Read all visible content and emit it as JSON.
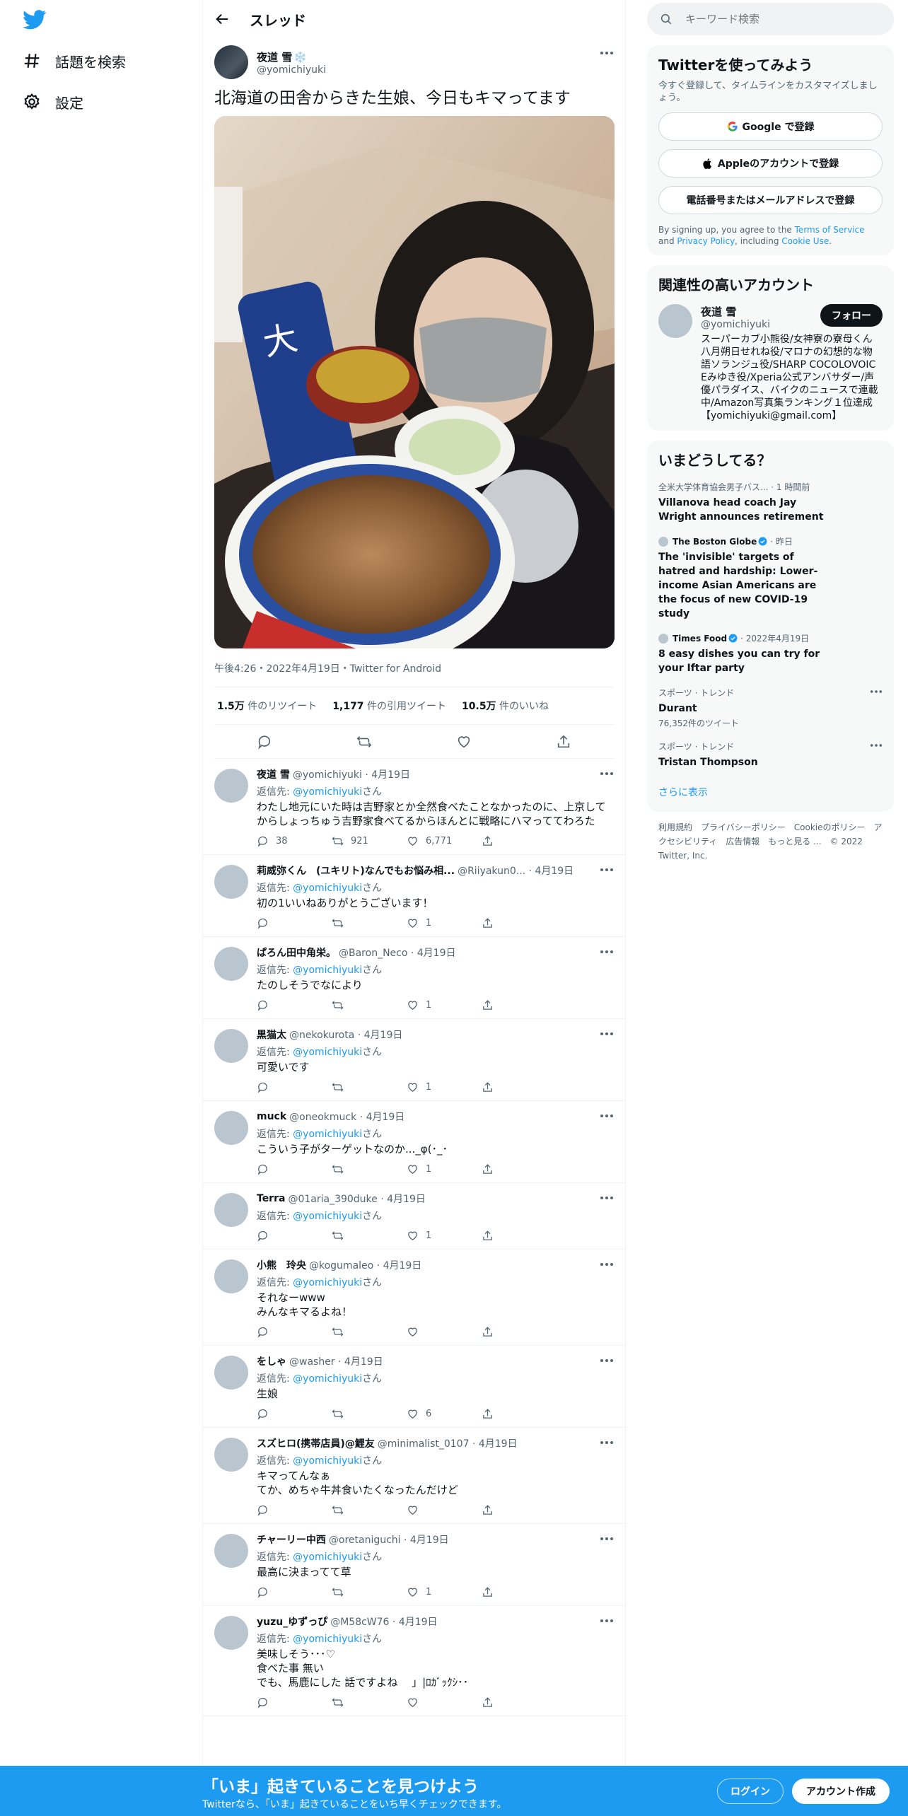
{
  "nav": {
    "explore_label": "話題を検索",
    "settings_label": "設定"
  },
  "header": {
    "title": "スレッド"
  },
  "tweet": {
    "author_name": "夜道 雪",
    "snow_emoji": "❄️",
    "author_handle": "@yomichiyuki",
    "text": "北海道の田舎からきた生娘、今日もキマってます",
    "meta": "午後4:26・2022年4月19日・Twitter for Android",
    "stats": [
      {
        "value": "1.5万",
        "label": "件のリツイート"
      },
      {
        "value": "1,177",
        "label": "件の引用ツイート"
      },
      {
        "value": "10.5万",
        "label": "件のいいね"
      }
    ]
  },
  "reply_to_prefix": "返信先: ",
  "reply_to_mention": "@yomichiyuki",
  "reply_to_suffix": "さん",
  "replies": [
    {
      "name": "夜道 雪",
      "handle": "@yomichiyuki · 4月19日",
      "text": "わたし地元にいた時は吉野家とか全然食べたことなかったのに、上京してからしょっちゅう吉野家食べてるからほんとに戦略にハマっててわろた",
      "reply_count": "38",
      "retweet_count": "921",
      "like_count": "6,771"
    },
    {
      "name": "莉威弥くん　(ユキリト)なんでもお悩み相...",
      "handle": "@Riiyakun0... · 4月19日",
      "text": "初の1いいねありがとうございます！",
      "reply_count": "",
      "retweet_count": "",
      "like_count": "1"
    },
    {
      "name": "ぱろん田中角栄。",
      "handle": "@Baron_Neco · 4月19日",
      "text": "たのしそうでなにより",
      "reply_count": "",
      "retweet_count": "",
      "like_count": "1"
    },
    {
      "name": "黒猫太",
      "handle": "@nekokurota · 4月19日",
      "text": "可愛いです",
      "reply_count": "",
      "retweet_count": "",
      "like_count": "1"
    },
    {
      "name": "muck",
      "handle": "@oneokmuck · 4月19日",
      "text": "こういう子がターゲットなのか..._φ(･_･",
      "reply_count": "",
      "retweet_count": "",
      "like_count": "1"
    },
    {
      "name": "Terra",
      "handle": "@01aria_390duke · 4月19日",
      "text": " ",
      "reply_count": "",
      "retweet_count": "",
      "like_count": "1"
    },
    {
      "name": "小熊　玲央",
      "handle": "@kogumaleo · 4月19日",
      "text": "それなーwww\nみんなキマるよね！",
      "reply_count": "",
      "retweet_count": "",
      "like_count": ""
    },
    {
      "name": "をしゃ",
      "handle": "@washer · 4月19日",
      "text": "生娘",
      "reply_count": "",
      "retweet_count": "",
      "like_count": "6"
    },
    {
      "name": "スズヒロ(携帯店員)@鯉友",
      "handle": "@minimalist_0107 · 4月19日",
      "text": "キマってんなぁ\nてか、めちゃ牛丼食いたくなったんだけど",
      "reply_count": "",
      "retweet_count": "",
      "like_count": ""
    },
    {
      "name": "チャーリー中西",
      "handle": "@oretaniguchi · 4月19日",
      "text": "最高に決まってて草",
      "reply_count": "",
      "retweet_count": "",
      "like_count": "1"
    },
    {
      "name": "yuzu_ゆずっぴ",
      "handle": "@M58cW76 · 4月19日",
      "text": "美味しそう･･･♡\n食べた事 無い\nでも、馬鹿にした 話ですよね　 」|ﾛｶﾞｯｸｼ･･",
      "reply_count": "",
      "retweet_count": "",
      "like_count": ""
    }
  ],
  "search": {
    "placeholder": "キーワード検索"
  },
  "signup": {
    "title": "Twitterを使ってみよう",
    "subtitle": "今すぐ登録して、タイムラインをカスタマイズしましょう。",
    "google_label": "Google で登録",
    "apple_label": "Appleのアカウントで登録",
    "phone_label": "電話番号またはメールアドレスで登録",
    "fine_1": "By signing up, you agree to the ",
    "terms": "Terms of Service",
    "fine_2": " and ",
    "privacy": "Privacy Policy",
    "fine_3": ", including ",
    "cookie": "Cookie Use",
    "fine_4": "."
  },
  "related": {
    "title": "関連性の高いアカウント",
    "name": "夜道 雪",
    "handle": "@yomichiyuki",
    "follow_label": "フォロー",
    "bio": "スーパーカブ小熊役/女神寮の寮母くん八月朔日せれね役/マロナの幻想的な物語ソランジュ役/SHARP COCOLOVOICEみゆき役/Xperia公式アンバサダー/声優パラダイス、バイクのニュースで連載中/Amazon写真集ランキング１位達成【yomichiyuki@gmail.com】"
  },
  "trends": {
    "title": "いまどうしてる？",
    "items": [
      {
        "source": "",
        "meta": "全米大学体育協会男子バス... · 1 時間前",
        "text": "Villanova head coach Jay Wright announces retirement",
        "count": ""
      },
      {
        "source": "The Boston Globe",
        "meta": " · 昨日",
        "text": "The 'invisible' targets of hatred and hardship: Lower-income Asian Americans are the focus of new COVID-19 study",
        "count": ""
      },
      {
        "source": "Times Food",
        "meta": " · 2022年4月19日",
        "text": "8 easy dishes you can try for your Iftar party",
        "count": ""
      },
      {
        "source": "",
        "meta": "スポーツ · トレンド",
        "text": "Durant",
        "count": "76,352件のツイート"
      },
      {
        "source": "",
        "meta": "スポーツ · トレンド",
        "text": "Tristan Thompson",
        "count": ""
      }
    ],
    "show_more": "さらに表示"
  },
  "footer": {
    "links": [
      "利用規約",
      "プライバシーポリシー",
      "Cookieのポリシー",
      "アクセシビリティ",
      "広告情報",
      "もっと見る ...",
      "© 2022 Twitter, Inc."
    ]
  },
  "bottom_bar": {
    "title": "「いま」起きていることを見つけよう",
    "subtitle": "Twitterなら、「いま」起きていることをいち早くチェックできます。",
    "login": "ログイン",
    "signup": "アカウント作成"
  },
  "colors": {
    "accent": "#1d9bf0",
    "text": "#0f1419",
    "muted": "#536471"
  }
}
